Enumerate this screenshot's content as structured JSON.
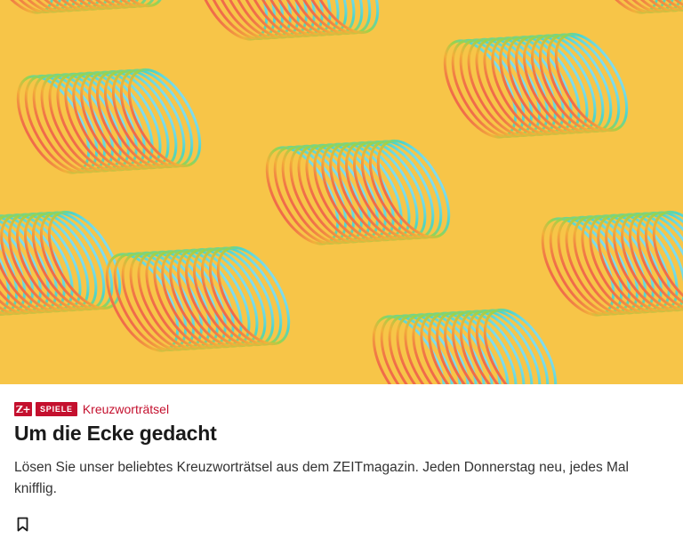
{
  "hero": {
    "image": "slinky-spring-toys-pattern",
    "background_color": "#f7c548"
  },
  "article": {
    "zplus_label": "Z+",
    "section_badge": "SPIELE",
    "kicker": "Kreuzworträtsel",
    "title": "Um die Ecke gedacht",
    "teaser": "Lösen Sie unser beliebtes Kreuzworträtsel aus dem ZEITmagazin. Jeden Donnerstag neu, jedes Mal knifflig."
  },
  "actions": {
    "bookmark_icon": "bookmark-icon"
  },
  "colors": {
    "accent": "#c4102e"
  }
}
